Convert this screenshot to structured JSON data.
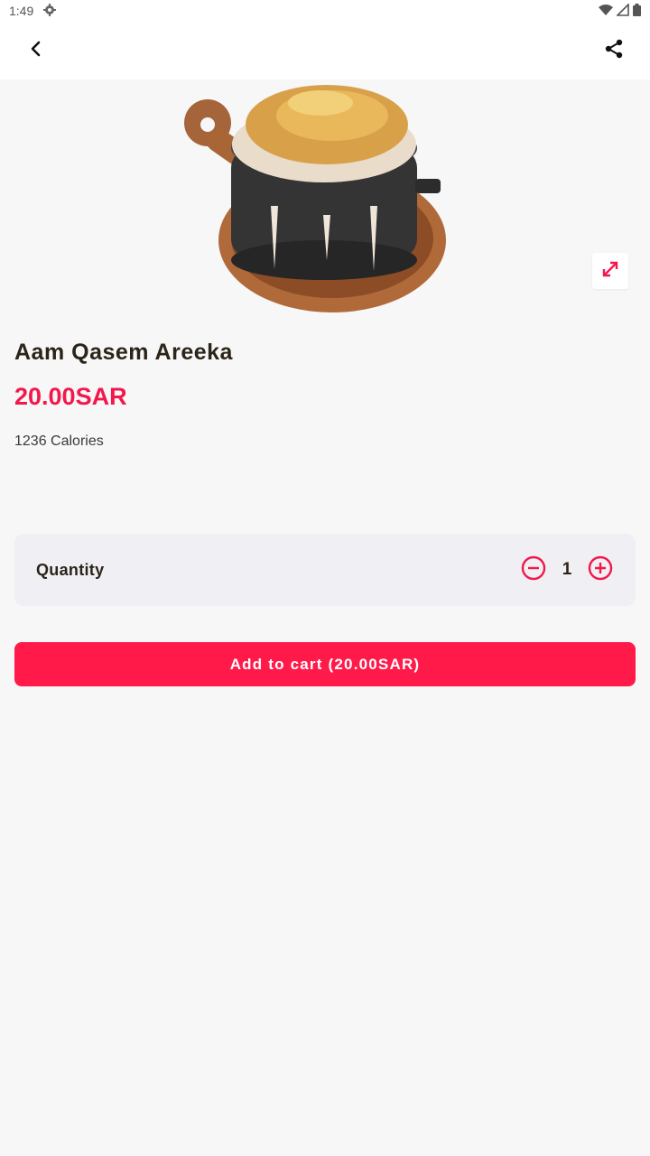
{
  "status_bar": {
    "time": "1:49"
  },
  "product": {
    "name": "Aam Qasem Areeka",
    "price": "20.00SAR",
    "calories": "1236 Calories"
  },
  "quantity": {
    "label": "Quantity",
    "value": "1"
  },
  "cart": {
    "add_label": "Add to cart (20.00SAR)"
  },
  "colors": {
    "accent": "#ff1a4a",
    "price": "#f2184c",
    "text": "#2b2418",
    "card": "#f0eff4",
    "background": "#f7f7f8"
  },
  "icons": {
    "back": "chevron-left-icon",
    "share": "share-icon",
    "expand": "expand-icon",
    "minus": "minus-circle-icon",
    "plus": "plus-circle-icon",
    "settings": "gear-icon",
    "wifi": "wifi-icon",
    "signal": "signal-icon",
    "battery": "battery-icon"
  }
}
